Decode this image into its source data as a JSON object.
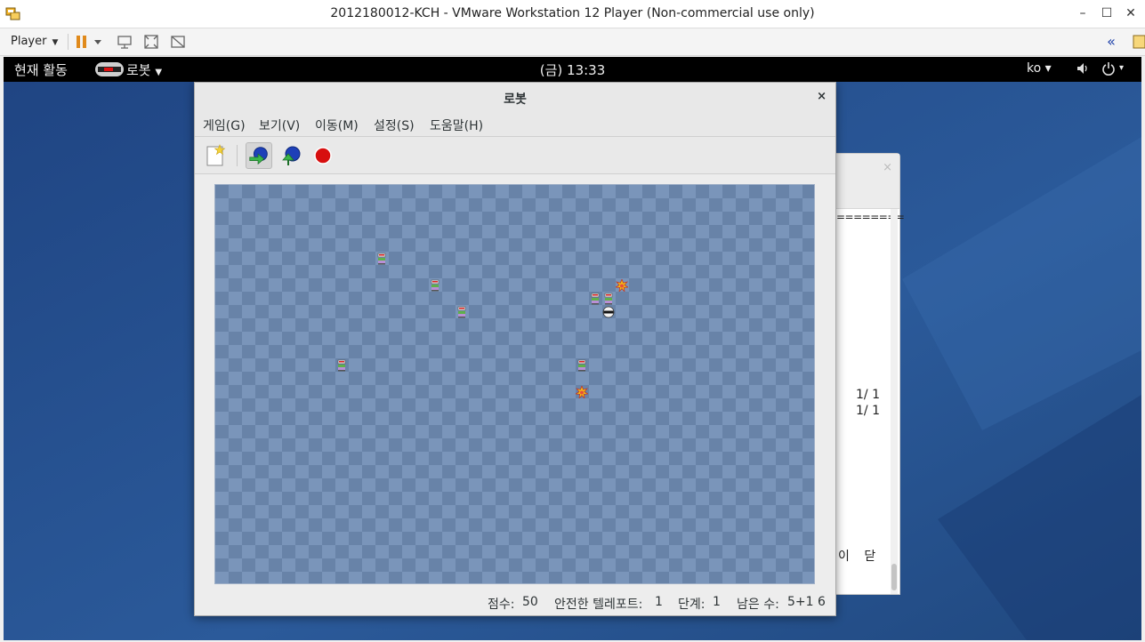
{
  "vmware": {
    "title": "2012180012-KCH - VMware Workstation 12 Player (Non-commercial use only)",
    "player_menu": "Player",
    "minimize": "–",
    "maximize": "☐",
    "close": "✕",
    "collapse": "«"
  },
  "gnome": {
    "activities": "현재 활동",
    "app_menu": "로봇",
    "clock": "(금) 13:33",
    "language": "ko ▾",
    "power_menu": "▾"
  },
  "background_window": {
    "separator": "========",
    "line1": "1/ 1",
    "line2": "1/ 1",
    "bottom_text": "이 닫"
  },
  "robots": {
    "title": "로봇",
    "close": "×",
    "menu": [
      "게임(G)",
      "보기(V)",
      "이동(M)",
      "설정(S)",
      "도움말(H)"
    ],
    "toolbar": [
      "new-game",
      "teleport",
      "random-teleport",
      "wait"
    ],
    "status": {
      "score_label": "점수:",
      "score_value": "50",
      "safe_teleports_label": "안전한 텔레포트:",
      "safe_teleports_value": "1",
      "level_label": "단계:",
      "level_value": "1",
      "remaining_label": "남은 수:",
      "remaining_value": "5+1 6"
    },
    "board_pieces": [
      {
        "type": "robot",
        "col": 16,
        "row": 7
      },
      {
        "type": "robot",
        "col": 18,
        "row": 9
      },
      {
        "type": "robot",
        "col": 9,
        "row": 13
      },
      {
        "type": "robot",
        "col": 12,
        "row": 5
      },
      {
        "type": "robot",
        "col": 28,
        "row": 8
      },
      {
        "type": "robot",
        "col": 27,
        "row": 13
      },
      {
        "type": "robot",
        "col": 29,
        "row": 8
      },
      {
        "type": "debris",
        "col": 30,
        "row": 7
      },
      {
        "type": "debris",
        "col": 27,
        "row": 15
      },
      {
        "type": "player",
        "col": 29,
        "row": 9
      }
    ],
    "board_cols": 45,
    "board_rows": 30
  }
}
